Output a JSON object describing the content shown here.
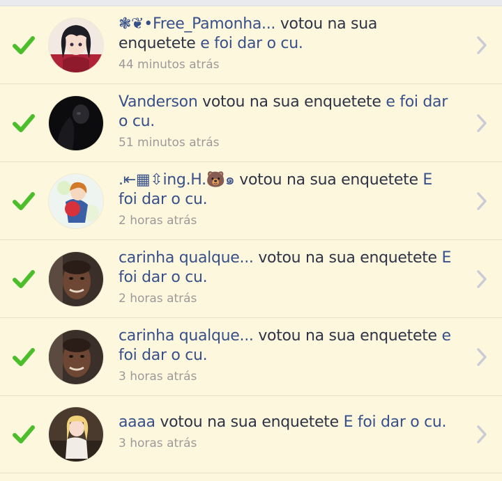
{
  "colors": {
    "background": "#fdf7de",
    "check": "#4cbe2b",
    "highlight_text": "#38508a",
    "body_text": "#2e3446",
    "timestamp": "#9a9a9a",
    "chevron": "#c9ccd6"
  },
  "notifications": [
    {
      "user": "❃❦•Free_Pamonha...",
      "action": " votou na sua enquetete ",
      "option": "e foi dar o cu.",
      "time": "44 minutos atrás",
      "status_icon": "check-icon",
      "avatar_icon": "anime-girl-avatar"
    },
    {
      "user": "Vanderson",
      "action": " votou na sua enquetete ",
      "option": "e foi dar o cu.",
      "time": "51 minutos atrás",
      "status_icon": "check-icon",
      "avatar_icon": "dark-figure-avatar"
    },
    {
      "user": ".⇤▦⇳ing.H.🐻๑",
      "action": " votou na sua enquetete ",
      "option": "E foi dar o cu.",
      "time": "2 horas atrás",
      "status_icon": "check-icon",
      "avatar_icon": "anime-boy-avatar"
    },
    {
      "user": "carinha qualque...",
      "action": " votou na sua enquetete ",
      "option": "E foi dar o cu.",
      "time": "2 horas atrás",
      "status_icon": "check-icon",
      "avatar_icon": "man-face-avatar"
    },
    {
      "user": "carinha qualque...",
      "action": " votou na sua enquetete ",
      "option": "e foi dar o cu.",
      "time": "3 horas atrás",
      "status_icon": "check-icon",
      "avatar_icon": "man-face-avatar"
    },
    {
      "user": "aaaa",
      "action": " votou na sua enquetete ",
      "option": "E foi dar o cu.",
      "time": "3 horas atrás",
      "status_icon": "check-icon",
      "avatar_icon": "anime-blonde-avatar"
    }
  ]
}
